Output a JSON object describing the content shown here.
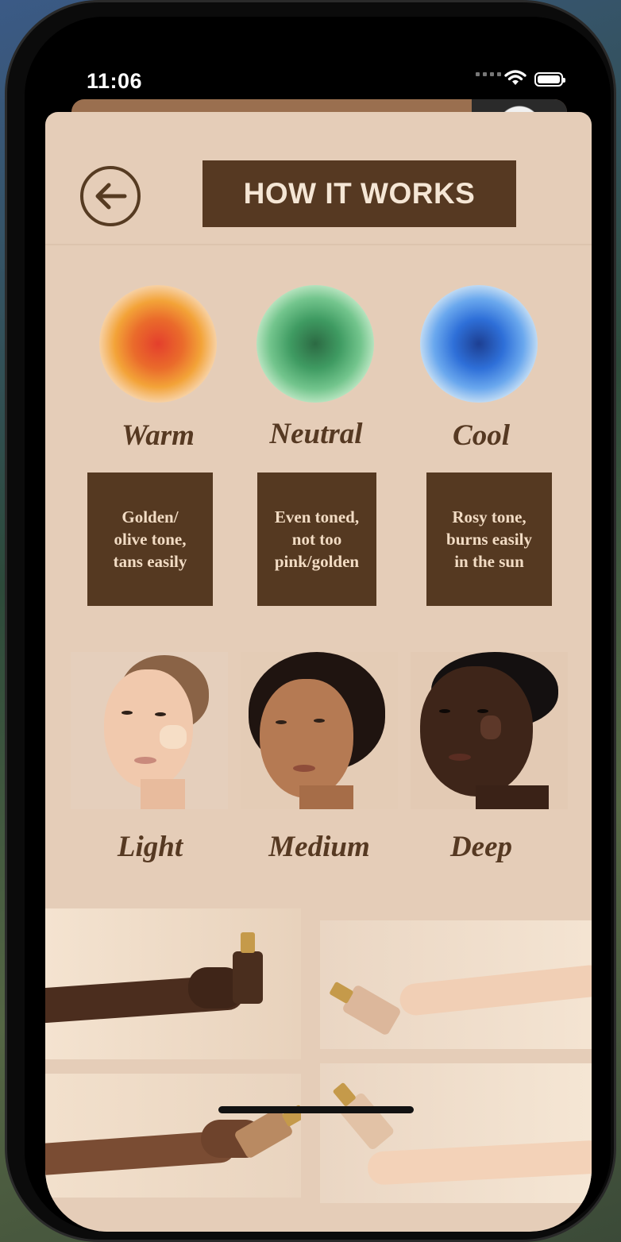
{
  "status_bar": {
    "time": "11:06"
  },
  "header": {
    "title": "HOW IT WORKS"
  },
  "undertones": [
    {
      "label": "Warm",
      "description": [
        "Golden/",
        "olive tone,",
        "tans easily"
      ]
    },
    {
      "label": "Neutral",
      "description": [
        "Even toned,",
        "not too",
        "pink/golden"
      ]
    },
    {
      "label": "Cool",
      "description": [
        "Rosy tone,",
        "burns easily",
        "in the sun"
      ]
    }
  ],
  "depths": [
    {
      "label": "Light"
    },
    {
      "label": "Medium"
    },
    {
      "label": "Deep"
    }
  ],
  "colors": {
    "sheet_bg": "#e5cdb8",
    "brand_brown": "#563922",
    "label_text": "#f2dcc4"
  }
}
